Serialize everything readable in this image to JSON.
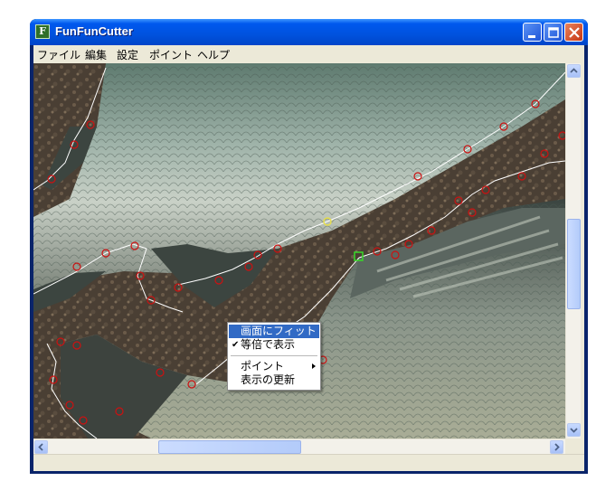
{
  "window": {
    "title": "FunFunCutter",
    "icon_letter": "F"
  },
  "title_buttons": {
    "minimize": "minimize-icon",
    "maximize": "maximize-icon",
    "close": "close-icon"
  },
  "menu": {
    "items": [
      "ファイル",
      "編集",
      "設定",
      "ポイント",
      "ヘルプ"
    ]
  },
  "context_menu": {
    "items": [
      {
        "label": "画面にフィット",
        "highlighted": true
      },
      {
        "label": "等倍で表示",
        "checked": true
      },
      {
        "label": "ポイント",
        "submenu": true
      },
      {
        "label": "表示の更新"
      }
    ]
  },
  "scrollbars": {
    "vertical_position": 0.45,
    "horizontal_position": 0.23
  },
  "colors": {
    "title_blue": "#0058ee",
    "outline": "#ffffff",
    "points": "#cc1111",
    "selected_point": "#39d22b",
    "highlight": "#316ac5"
  }
}
